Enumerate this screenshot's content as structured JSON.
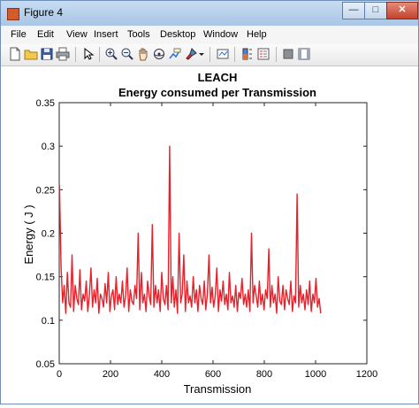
{
  "window": {
    "title": "Figure 4",
    "minimize_label": "—",
    "maximize_label": "□",
    "close_label": "✕"
  },
  "menu": {
    "items": [
      "File",
      "Edit",
      "View",
      "Insert",
      "Tools",
      "Desktop",
      "Window",
      "Help"
    ]
  },
  "toolbar": {
    "icons": [
      "new-figure-icon",
      "open-file-icon",
      "save-icon",
      "print-icon",
      "select-arrow-icon",
      "zoom-in-icon",
      "zoom-out-icon",
      "pan-hand-icon",
      "rotate-3d-icon",
      "data-cursor-icon",
      "brush-icon",
      "dropdown-arrow-icon",
      "link-plot-icon",
      "insert-colorbar-icon",
      "hide-plot-tools-icon",
      "show-plot-tools-icon"
    ]
  },
  "colors": {
    "line": "#e8202a",
    "axes": "#262626",
    "text": "#000000"
  },
  "chart_data": {
    "type": "line",
    "title": "LEACH",
    "subtitle": "Energy consumed per Transmission",
    "xlabel": "Transmission",
    "ylabel": "Energy ( J )",
    "xlim": [
      0,
      1200
    ],
    "ylim": [
      0.05,
      0.35
    ],
    "xticks": [
      0,
      200,
      400,
      600,
      800,
      1000,
      1200
    ],
    "yticks": [
      0.05,
      0.1,
      0.15,
      0.2,
      0.25,
      0.3,
      0.35
    ],
    "xtick_labels": [
      "0",
      "200",
      "400",
      "600",
      "800",
      "1000",
      "1200"
    ],
    "ytick_labels": [
      "0.05",
      "0.1",
      "0.15",
      "0.2",
      "0.25",
      "0.3",
      "0.35"
    ],
    "grid": false,
    "series": [
      {
        "x_start": 1,
        "x_end": 1020,
        "baseline_range": [
          0.105,
          0.135
        ],
        "values": [
          0.255,
          0.16,
          0.12,
          0.14,
          0.108,
          0.155,
          0.12,
          0.115,
          0.175,
          0.11,
          0.14,
          0.125,
          0.118,
          0.158,
          0.112,
          0.13,
          0.122,
          0.145,
          0.11,
          0.128,
          0.16,
          0.115,
          0.135,
          0.12,
          0.148,
          0.108,
          0.13,
          0.125,
          0.115,
          0.142,
          0.12,
          0.155,
          0.11,
          0.128,
          0.135,
          0.112,
          0.15,
          0.118,
          0.13,
          0.12,
          0.145,
          0.115,
          0.128,
          0.16,
          0.11,
          0.135,
          0.122,
          0.118,
          0.14,
          0.125,
          0.2,
          0.112,
          0.155,
          0.12,
          0.13,
          0.11,
          0.145,
          0.128,
          0.118,
          0.21,
          0.115,
          0.14,
          0.12,
          0.135,
          0.11,
          0.155,
          0.125,
          0.118,
          0.14,
          0.112,
          0.3,
          0.12,
          0.15,
          0.115,
          0.135,
          0.108,
          0.2,
          0.12,
          0.13,
          0.175,
          0.11,
          0.145,
          0.12,
          0.128,
          0.115,
          0.15,
          0.12,
          0.135,
          0.11,
          0.14,
          0.125,
          0.118,
          0.145,
          0.112,
          0.13,
          0.175,
          0.12,
          0.138,
          0.115,
          0.128,
          0.16,
          0.11,
          0.135,
          0.122,
          0.145,
          0.118,
          0.13,
          0.112,
          0.155,
          0.12,
          0.128,
          0.115,
          0.14,
          0.11,
          0.132,
          0.125,
          0.148,
          0.118,
          0.13,
          0.115,
          0.135,
          0.11,
          0.2,
          0.12,
          0.14,
          0.128,
          0.115,
          0.145,
          0.118,
          0.13,
          0.112,
          0.135,
          0.125,
          0.182,
          0.115,
          0.14,
          0.12,
          0.13,
          0.108,
          0.15,
          0.122,
          0.118,
          0.14,
          0.112,
          0.135,
          0.125,
          0.118,
          0.145,
          0.11,
          0.128,
          0.12,
          0.245,
          0.115,
          0.14,
          0.12,
          0.13,
          0.112,
          0.135,
          0.118,
          0.145,
          0.11,
          0.13,
          0.12,
          0.148,
          0.115,
          0.125,
          0.108
        ]
      }
    ]
  }
}
